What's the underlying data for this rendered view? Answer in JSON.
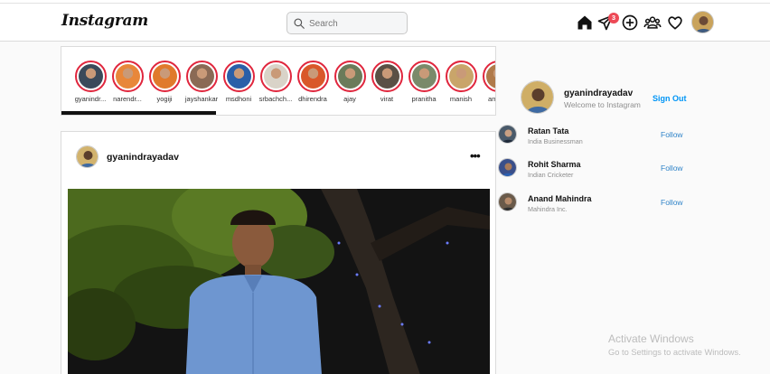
{
  "app": {
    "logo_text": "Instagram"
  },
  "search": {
    "placeholder": "Search",
    "value": ""
  },
  "nav": {
    "icons": [
      "home-icon",
      "direct-icon",
      "add-post-icon",
      "explore-icon",
      "activity-icon"
    ],
    "notification_count": "3"
  },
  "stories": [
    {
      "name": "gyanindr...",
      "avatar_color": "#3b4a5a"
    },
    {
      "name": "narendr...",
      "avatar_color": "#e8873a"
    },
    {
      "name": "yogiji",
      "avatar_color": "#e07a2c"
    },
    {
      "name": "jayshankar",
      "avatar_color": "#8a6a55"
    },
    {
      "name": "msdhoni",
      "avatar_color": "#2a5fa8"
    },
    {
      "name": "srbachch...",
      "avatar_color": "#d9d3c8"
    },
    {
      "name": "dhirendra",
      "avatar_color": "#d9582a"
    },
    {
      "name": "ajay",
      "avatar_color": "#6b7b5a"
    },
    {
      "name": "virat",
      "avatar_color": "#5a5045"
    },
    {
      "name": "pranitha",
      "avatar_color": "#7a8a6a"
    },
    {
      "name": "manish",
      "avatar_color": "#c9a56a"
    },
    {
      "name": "amitsh",
      "avatar_color": "#b07a4a"
    }
  ],
  "post": {
    "username": "gyanindrayadav",
    "more_label": "•••"
  },
  "sidebar": {
    "username": "gyanindrayadav",
    "subtitle": "Welcome to Instagram",
    "signout_label": "Sign Out",
    "suggestions": [
      {
        "name": "Ratan Tata",
        "desc": "India Businessman",
        "action": "Follow"
      },
      {
        "name": "Rohit Sharma",
        "desc": "Indian Cricketer",
        "action": "Follow"
      },
      {
        "name": "Anand Mahindra",
        "desc": "Mahindra Inc.",
        "action": "Follow"
      }
    ]
  },
  "watermark": {
    "title": "Activate Windows",
    "subtitle": "Go to Settings to activate Windows."
  },
  "colors": {
    "accent": "#0095f6",
    "badge": "#ed4956",
    "story_ring": "#e0263d"
  }
}
